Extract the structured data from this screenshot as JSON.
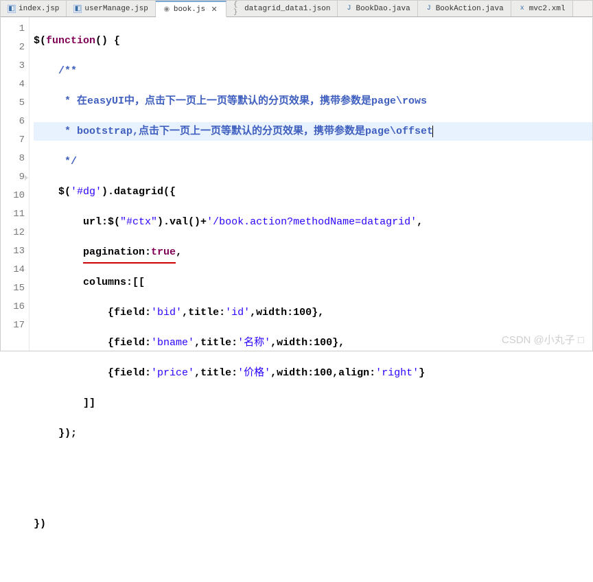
{
  "tabs": [
    {
      "label": "index.jsp",
      "icon": "jsp-icon"
    },
    {
      "label": "userManage.jsp",
      "icon": "jsp-icon"
    },
    {
      "label": "book.js",
      "icon": "js-icon",
      "active": true,
      "closable": true,
      "dirty": "✕"
    },
    {
      "label": "datagrid_data1.json",
      "icon": "json-icon"
    },
    {
      "label": "BookDao.java",
      "icon": "java-icon"
    },
    {
      "label": "BookAction.java",
      "icon": "java-icon"
    },
    {
      "label": "mvc2.xml",
      "icon": "xml-icon"
    }
  ],
  "icons": {
    "jsp": "◧",
    "js": "◉",
    "json": "{ }",
    "java": "J",
    "xml": "x",
    "close": "✕"
  },
  "gutter": [
    "1",
    "2",
    "3",
    "4",
    "5",
    "6",
    "7",
    "8",
    "9",
    "10",
    "11",
    "12",
    "13",
    "14",
    "15",
    "16",
    "17"
  ],
  "code": {
    "l1_a": "$(",
    "l1_b": "function",
    "l1_c": "() {",
    "l2": "/**",
    "l3": " * 在easyUI中，点击下一页上一页等默认的分页效果，携带参数是page\\rows",
    "l4": " * bootstrap,点击下一页上一页等默认的分页效果，携带参数是page\\offset",
    "l5": " */",
    "l6_a": "$(",
    "l6_b": "'#dg'",
    "l6_c": ").datagrid({",
    "l7_a": "url:$(",
    "l7_b": "\"#ctx\"",
    "l7_c": ").val()+",
    "l7_d": "'/book.action?methodName=datagrid'",
    "l7_e": ",",
    "l8_a": "pagination:",
    "l8_b": "true",
    "l8_c": ",",
    "l9": "columns:[[",
    "l10_a": "{field:",
    "l10_b": "'bid'",
    "l10_c": ",title:",
    "l10_d": "'id'",
    "l10_e": ",width:100},",
    "l11_a": "{field:",
    "l11_b": "'bname'",
    "l11_c": ",title:",
    "l11_d": "'名称'",
    "l11_e": ",width:100},",
    "l12_a": "{field:",
    "l12_b": "'price'",
    "l12_c": ",title:",
    "l12_d": "'价格'",
    "l12_e": ",width:100,align:",
    "l12_f": "'right'",
    "l12_g": "}",
    "l13": "]]",
    "l14": "});",
    "l17": "})"
  },
  "watermark": "CSDN @小丸子 □"
}
